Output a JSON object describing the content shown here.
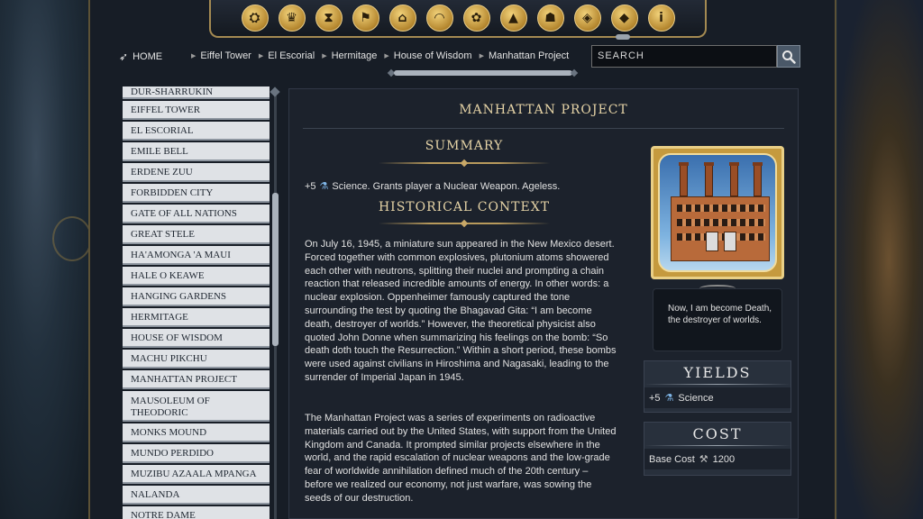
{
  "nav": {
    "home_label": "HOME",
    "breadcrumbs": [
      "Eiffel Tower",
      "El Escorial",
      "Hermitage",
      "House of Wisdom",
      "Manhattan Project"
    ]
  },
  "search": {
    "placeholder": "SEARCH"
  },
  "category_icons": [
    "civilizations-icon",
    "leaders-icon",
    "city-states-icon",
    "districts-icon",
    "buildings-icon",
    "wonders-icon",
    "units-icon",
    "unit-promotions-icon",
    "great-people-icon",
    "technologies-icon",
    "resources-icon",
    "info-icon"
  ],
  "list": {
    "items": [
      "Dur-Sharrukin",
      "Eiffel Tower",
      "El Escorial",
      "Emile Bell",
      "Erdene Zuu",
      "Forbidden City",
      "Gate of All Nations",
      "Great Stele",
      "Ha'amonga 'a Maui",
      "Hale o Keawe",
      "Hanging Gardens",
      "Hermitage",
      "House of Wisdom",
      "Machu Pikchu",
      "Manhattan Project",
      "Mausoleum of Theodoric",
      "Monks Mound",
      "Mundo Perdido",
      "Muzibu Azaala Mpanga",
      "Nalanda",
      "Notre Dame"
    ]
  },
  "article": {
    "title": "MANHATTAN PROJECT",
    "summary_heading": "SUMMARY",
    "summary_amount": "+5",
    "summary_text": "Science. Grants player a Nuclear Weapon. Ageless.",
    "history_heading": "HISTORICAL CONTEXT",
    "paragraph1": "On July 16, 1945, a miniature sun appeared in the New Mexico desert. Forced together with common explosives, plutonium atoms showered each other with neutrons, splitting their nuclei and prompting a chain reaction that released incredible amounts of energy. In other words: a nuclear explosion. Oppenheimer famously captured the tone surrounding the test by quoting the Bhagavad Gita: “I am become death, destroyer of worlds.” However, the theoretical physicist also quoted John Donne when summarizing his feelings on the bomb: “So death doth touch the Resurrection.” Within a short period, these bombs were used against civilians in Hiroshima and Nagasaki, leading to the surrender of Imperial Japan in 1945.",
    "paragraph2": "The Manhattan Project was a series of experiments on radioactive materials carried out by the United States, with support from the United Kingdom and Canada. It prompted similar projects elsewhere in the world, and the rapid escalation of nuclear weapons and the low-grade fear of worldwide annihilation defined much of the 20th century – before we realized our economy, not just warfare, was sowing the seeds of our destruction."
  },
  "quote": "Now, I am become Death, the destroyer of worlds.",
  "yields": {
    "heading": "YIELDS",
    "amount": "+5",
    "label": "Science"
  },
  "cost": {
    "heading": "COST",
    "label": "Base Cost",
    "value": "1200"
  },
  "colors": {
    "accent_gold": "#e5d3a6",
    "list_bg": "#dfe2e6",
    "panel_bg": "#171d26"
  }
}
